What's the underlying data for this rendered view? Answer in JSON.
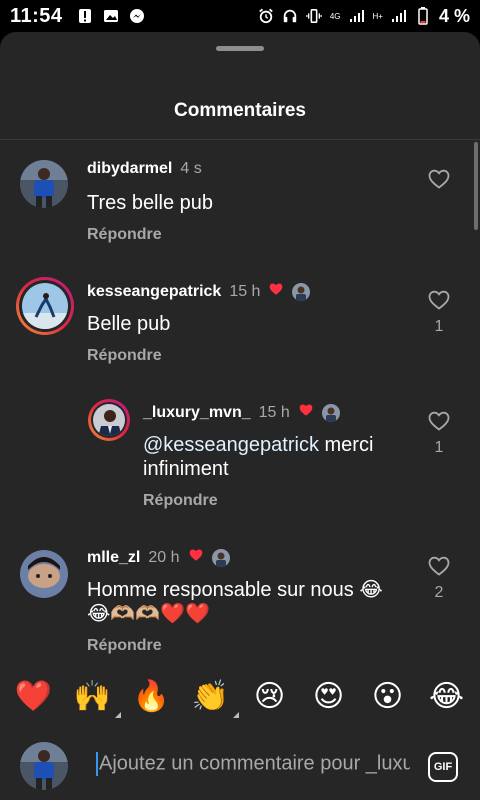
{
  "status_bar": {
    "time": "11:54",
    "network_4g": "4G",
    "network_h": "H+",
    "battery_percent": "4 %"
  },
  "sheet": {
    "title": "Commentaires"
  },
  "comments": [
    {
      "username": "dibydarmel",
      "time": "4 s",
      "text": "Tres belle pub",
      "reply_label": "Répondre",
      "like_count": ""
    },
    {
      "username": "kesseangepatrick",
      "time": "15 h",
      "text": "Belle pub",
      "reply_label": "Répondre",
      "like_count": "1"
    },
    {
      "username": "_luxury_mvn_",
      "time": "15 h",
      "mention": "@kesseangepatrick",
      "text": " merci infiniment",
      "reply_label": "Répondre",
      "like_count": "1"
    },
    {
      "username": "mlle_zl",
      "time": "20 h",
      "text": "Homme responsable sur nous 😂",
      "text_line2": "😂🫶🏼🫶🏼❤️❤️",
      "reply_label": "Répondre",
      "like_count": "2"
    }
  ],
  "emoji_bar": [
    "❤️",
    "🙌",
    "🔥",
    "👏",
    "😢",
    "😍",
    "😮",
    "😂"
  ],
  "compose": {
    "placeholder": "Ajoutez un commentaire pour _luxury_mvn_",
    "gif_label": "GIF"
  },
  "colors": {
    "sheet_bg": "#262626",
    "secondary_text": "#a8a8a8",
    "heart_red": "#ff3040"
  }
}
